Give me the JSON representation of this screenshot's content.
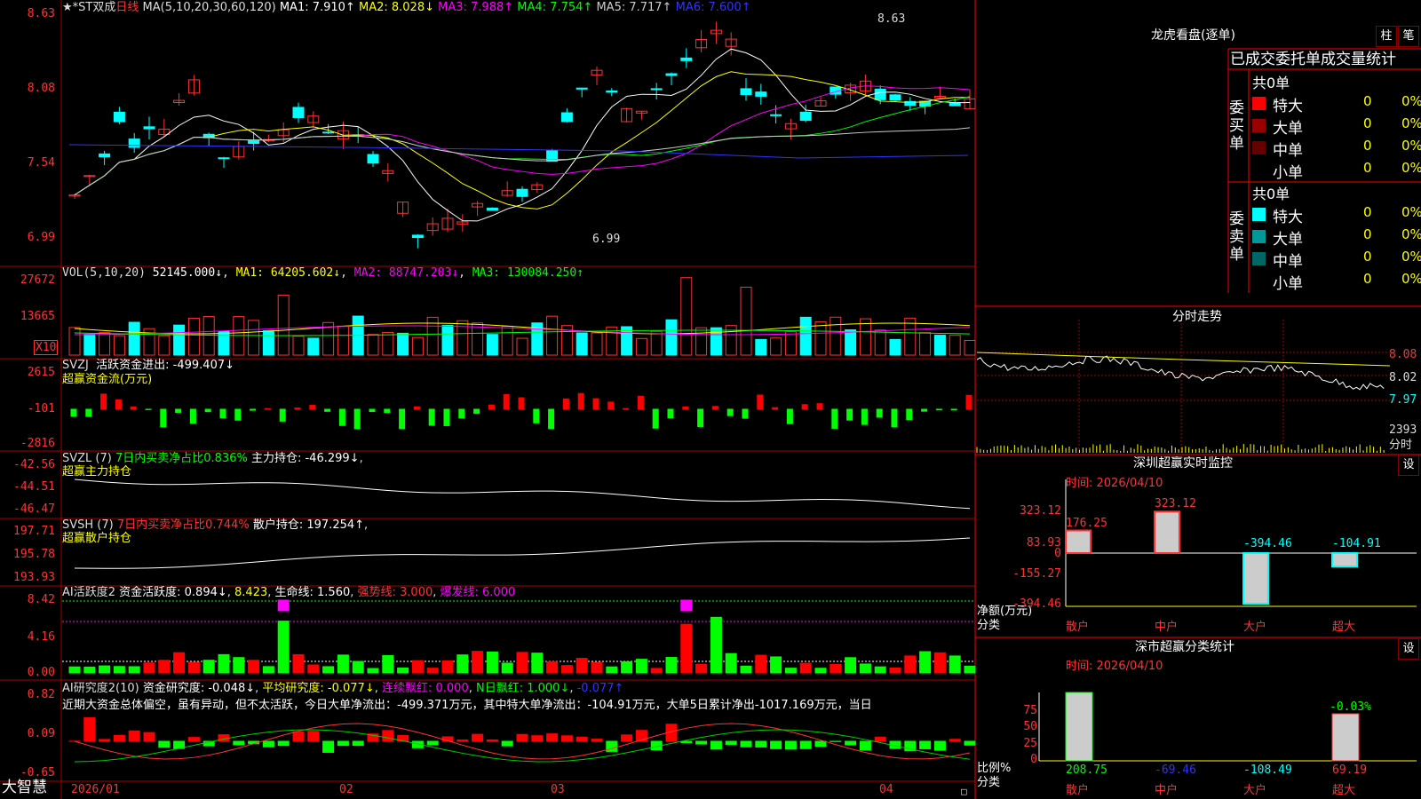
{
  "app": {
    "logo": "大智慧"
  },
  "main_chart": {
    "stock_prefix": "★*ST双成",
    "period": "日线",
    "ma_params": "MA(5,10,20,30,60,120)",
    "ma": [
      {
        "label": "MA1: 7.910↑",
        "color": "#ffffff"
      },
      {
        "label": "MA2: 8.028↓",
        "color": "#ffff00"
      },
      {
        "label": "MA3: 7.988↑",
        "color": "#ff00ff"
      },
      {
        "label": "MA4: 7.754↑",
        "color": "#00ff00"
      },
      {
        "label": "MA5: 7.717↑",
        "color": "#cccccc"
      },
      {
        "label": "MA6: 7.600↑",
        "color": "#3333ff"
      }
    ],
    "yaxis": [
      "8.63",
      "8.08",
      "7.54",
      "6.99"
    ],
    "high_note": "8.63",
    "low_note": "6.99",
    "date_axis": [
      "2026/01",
      "02",
      "03",
      "04"
    ]
  },
  "vol": {
    "header_name": "VOL(5,10,20)",
    "value": "52145.000↓",
    "ma1": "MA1: 64205.602↓",
    "ma2": "MA2: 88747.203↓",
    "ma3": "MA3: 130084.250↑",
    "yaxis": [
      "27672",
      "13665"
    ],
    "unit": "X10"
  },
  "svzj": {
    "header_name": "SVZJ",
    "label": "活跃资金进出: -499.407↓",
    "subtitle": "超赢资金流(万元)",
    "yaxis": [
      "2615",
      "-101",
      "-2816"
    ]
  },
  "svzl": {
    "header_name": "SVZL (7)",
    "label1": "7日内买卖净占比0.836%",
    "label2": "主力持仓: -46.299↓",
    "subtitle": "超赢主力持仓",
    "yaxis": [
      "-42.56",
      "-44.51",
      "-46.47"
    ]
  },
  "svsh": {
    "header_name": "SVSH (7)",
    "label1": "7日内买卖净占比0.744%",
    "label2": "散户持仓: 197.254↑",
    "subtitle": "超赢散户持仓",
    "yaxis": [
      "197.71",
      "195.78",
      "193.93"
    ]
  },
  "ai_active": {
    "header_name": "AI活跃度2",
    "label1": "资金活跃度: 0.894↓",
    "label2": "8.423",
    "label3": "生命线: 1.560",
    "label4": "强势线: 3.000",
    "label5": "爆发线: 6.000",
    "yaxis": [
      "8.42",
      "4.16",
      "0.00"
    ]
  },
  "ai_research": {
    "header_name": "AI研究度2(10)",
    "label1": "资金研究度: -0.048↓",
    "label2": "平均研究度: -0.077↓",
    "label3": "连续飘红: 0.000",
    "label4": "N日飘红: 1.000↓",
    "label5": "-0.077↑",
    "commentary": "近期大资金总体偏空，虽有异动，但不太活跃，今日大单净流出：-499.371万元，其中特大单净流出：-104.91万元，大单5日累计净出-1017.169万元，当日",
    "yaxis": [
      "0.82",
      "0.09",
      "-0.65"
    ]
  },
  "dragon_tiger": {
    "title": "龙虎看盘(逐单)",
    "btn_bar": "柱",
    "btn_tick": "笔",
    "tab_label": "已成交委托单成交量统计",
    "buy": {
      "side_label": "委买单",
      "total": "共0单",
      "rows": [
        {
          "name": "特大",
          "count": "0",
          "pct": "0%",
          "color": "#ff0000"
        },
        {
          "name": "大单",
          "count": "0",
          "pct": "0%",
          "color": "#990000"
        },
        {
          "name": "中单",
          "count": "0",
          "pct": "0%",
          "color": "#660000"
        },
        {
          "name": "小单",
          "count": "0",
          "pct": "0%",
          "color": "#000000"
        }
      ]
    },
    "sell": {
      "side_label": "委卖单",
      "total": "共0单",
      "rows": [
        {
          "name": "特大",
          "count": "0",
          "pct": "0%",
          "color": "#00ffff"
        },
        {
          "name": "大单",
          "count": "0",
          "pct": "0%",
          "color": "#009999"
        },
        {
          "name": "中单",
          "count": "0",
          "pct": "0%",
          "color": "#006666"
        },
        {
          "name": "小单",
          "count": "0",
          "pct": "0%",
          "color": "#000000"
        }
      ]
    }
  },
  "intraday": {
    "title": "分时走势",
    "prices": [
      "8.08",
      "8.02",
      "7.97"
    ],
    "vol_max": "2393",
    "vol_label": "分时"
  },
  "sz_monitor": {
    "title": "深圳超赢实时监控",
    "settings": "设",
    "time": "时间: 2026/04/10",
    "yaxis": [
      "323.12",
      "83.93",
      "0",
      "-155.27",
      "-394.46"
    ],
    "y_caption": "净额(万元)",
    "x_caption": "分类",
    "categories": [
      "散户",
      "中户",
      "大户",
      "超大"
    ],
    "values": [
      176.25,
      323.12,
      -394.46,
      -104.91
    ],
    "value_labels": [
      "176.25",
      "323.12",
      "-394.46",
      "-104.91"
    ]
  },
  "sz_stats": {
    "title": "深市超赢分类统计",
    "settings": "设",
    "time": "时间: 2026/04/10",
    "yaxis": [
      "75",
      "50",
      "25",
      "0"
    ],
    "y_caption": "比例%",
    "x_caption": "分类",
    "categories": [
      "散户",
      "中户",
      "大户",
      "超大"
    ],
    "bottom_values": [
      "208.75",
      "-69.46",
      "-108.49",
      "69.19"
    ],
    "top_label": "-0.03%"
  }
}
